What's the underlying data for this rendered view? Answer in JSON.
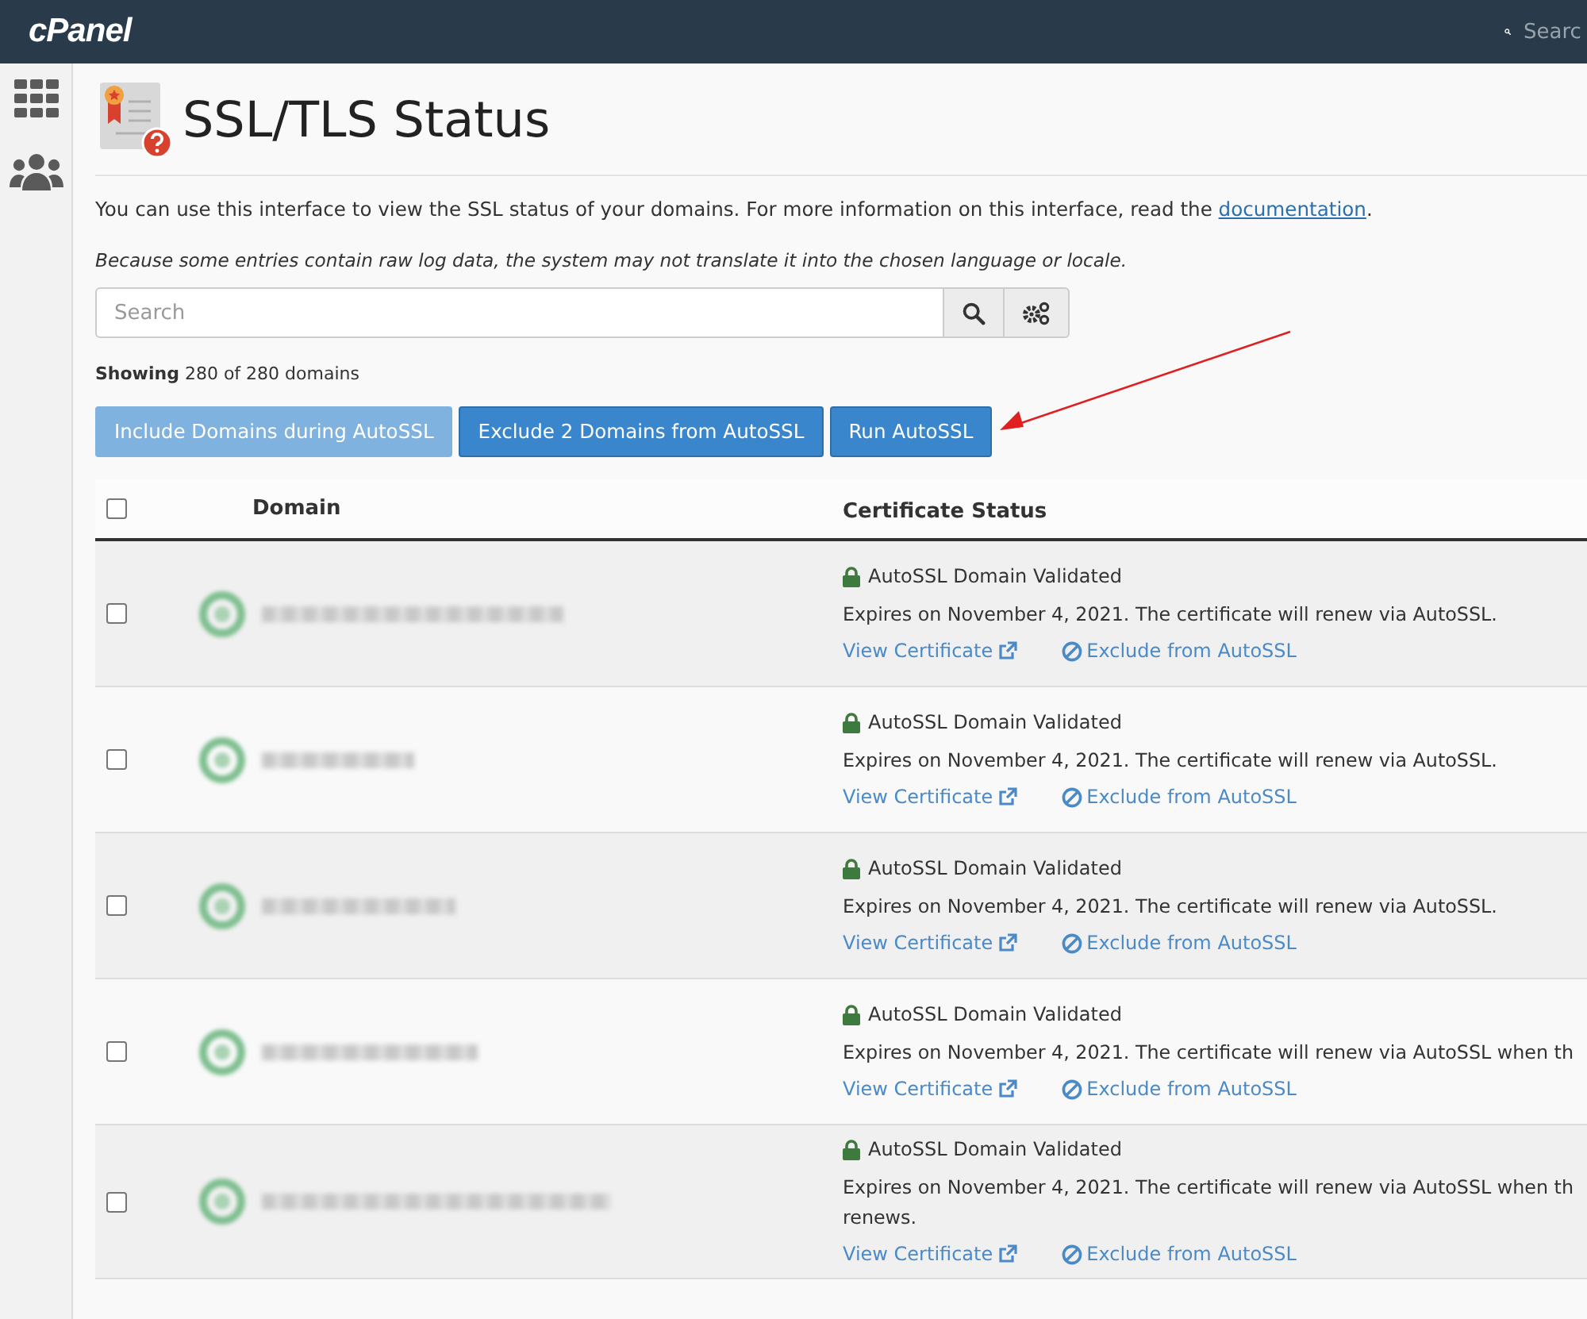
{
  "topbar": {
    "logo": "cPanel",
    "search_placeholder": "Searc"
  },
  "page": {
    "title": "SSL/TLS Status",
    "intro": "You can use this interface to view the SSL status of your domains. For more information on this interface, read the",
    "intro_link": "documentation",
    "intro_end": ".",
    "note": "Because some entries contain raw log data, the system may not translate it into the chosen language or locale."
  },
  "search": {
    "placeholder": "Search"
  },
  "showing": {
    "label": "Showing",
    "text": "280 of 280 domains"
  },
  "buttons": [
    {
      "label": "Include Domains during AutoSSL",
      "disabled": true
    },
    {
      "label": "Exclude 2 Domains from AutoSSL",
      "disabled": false
    },
    {
      "label": "Run AutoSSL",
      "disabled": false
    }
  ],
  "table": {
    "columns": [
      "Domain",
      "Certificate Status"
    ],
    "select_all": false,
    "rows": [
      {
        "checked": false,
        "status": "AutoSSL Domain Validated",
        "expiry": [
          "Expires on November 4, 2021. The certificate will renew via AutoSSL."
        ],
        "view": "View Certificate",
        "exclude": "Exclude from AutoSSL"
      },
      {
        "checked": false,
        "status": "AutoSSL Domain Validated",
        "expiry": [
          "Expires on November 4, 2021. The certificate will renew via AutoSSL."
        ],
        "view": "View Certificate",
        "exclude": "Exclude from AutoSSL"
      },
      {
        "checked": false,
        "status": "AutoSSL Domain Validated",
        "expiry": [
          "Expires on November 4, 2021. The certificate will renew via AutoSSL."
        ],
        "view": "View Certificate",
        "exclude": "Exclude from AutoSSL"
      },
      {
        "checked": false,
        "status": "AutoSSL Domain Validated",
        "expiry": [
          "Expires on November 4, 2021. The certificate will renew via AutoSSL when th"
        ],
        "view": "View Certificate",
        "exclude": "Exclude from AutoSSL"
      },
      {
        "checked": false,
        "status": "AutoSSL Domain Validated",
        "expiry": [
          "Expires on November 4, 2021. The certificate will renew via AutoSSL when th",
          "renews."
        ],
        "view": "View Certificate",
        "exclude": "Exclude from AutoSSL"
      }
    ]
  }
}
